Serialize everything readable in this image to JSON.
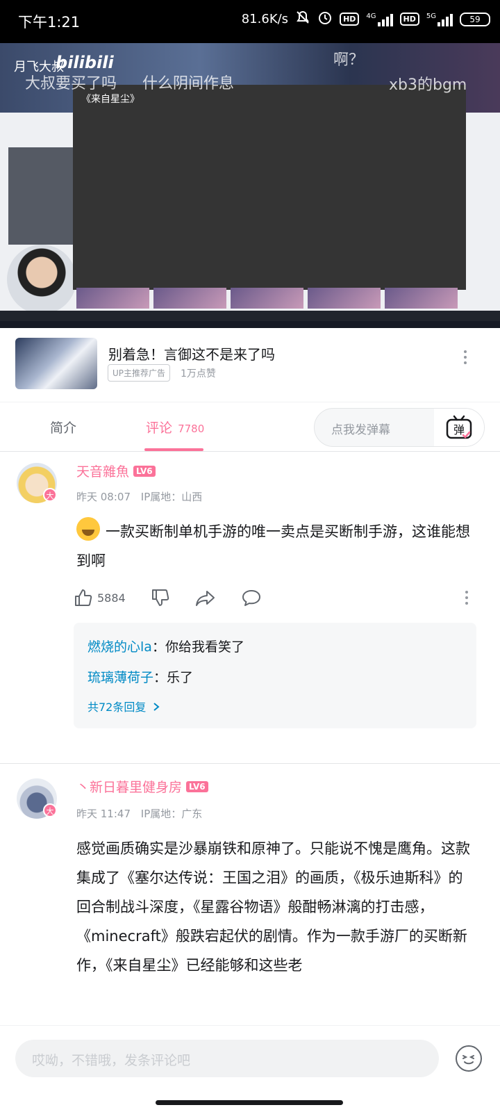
{
  "status_bar": {
    "time": "下午1:21",
    "network_speed": "81.6K/s",
    "hd1": "HD",
    "hd2": "HD",
    "net1": "4G",
    "net2": "5G",
    "battery": "59"
  },
  "video": {
    "streamer_name": "月飞大叔",
    "site_logo": "bilibili",
    "window_title": "《来自星尘》",
    "danmaku": [
      "啊？",
      "什么阴间作息",
      "xb3的bgm",
      "大叔要买了吗"
    ]
  },
  "ad": {
    "title": "别着急！言御这不是来了吗",
    "tag": "UP主推荐广告",
    "likes": "1万点赞"
  },
  "tabs": {
    "intro": "简介",
    "comments": "评论",
    "comments_count": "7780",
    "danmaku_placeholder": "点我发弹幕",
    "danmaku_button_icon": "danmaku-tv-icon"
  },
  "comments": [
    {
      "username": "天音雜魚",
      "level": "LV6",
      "avatar_badge": "大",
      "time": "昨天 08:07",
      "ip_label": "IP属地：",
      "ip_location": "山西",
      "content": "一款买断制单机手游的唯一卖点是买断制手游，这谁能想到啊",
      "likes": "5884",
      "replies": [
        {
          "user": "燃烧的心la",
          "text": "你给我看笑了"
        },
        {
          "user": "琉璃薄荷子",
          "text": "乐了"
        }
      ],
      "reply_count_text": "共72条回复"
    },
    {
      "username": "丶新日暮里健身房",
      "level": "LV6",
      "avatar_badge": "大",
      "time": "昨天 11:47",
      "ip_label": "IP属地：",
      "ip_location": "广东",
      "content": "感觉画质确实是沙暴崩铁和原神了。只能说不愧是鹰角。这款集成了《塞尔达传说：王国之泪》的画质，《极乐迪斯科》的回合制战斗深度，《星露谷物语》般酣畅淋漓的打击感，《minecraft》般跌宕起伏的剧情。作为一款手游厂的买断新作，《来自星尘》已经能够和这些老"
    }
  ],
  "bottom": {
    "input_placeholder": "哎呦，不错哦，发条评论吧"
  },
  "colors": {
    "accent_pink": "#fb7299",
    "link_blue": "#008ac5",
    "text_gray": "#9499a0"
  }
}
